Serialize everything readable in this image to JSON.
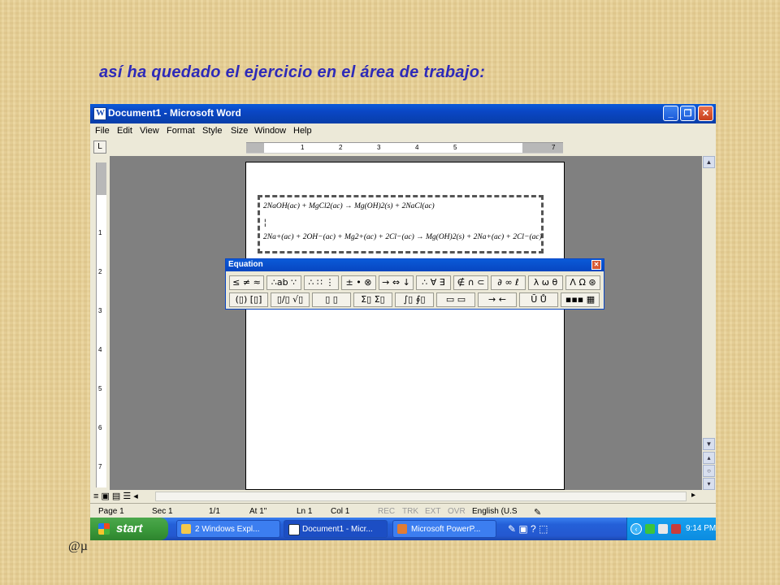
{
  "caption": "así ha quedado el ejercicio en el área de trabajo:",
  "corner_mark": "@µ",
  "window": {
    "title": "Document1 - Microsoft Word",
    "app_icon": "W",
    "buttons": {
      "minimize": "_",
      "maximize": "❐",
      "close": "✕"
    }
  },
  "menu": [
    "File",
    "Edit",
    "View",
    "Format",
    "Style",
    "Size",
    "Window",
    "Help"
  ],
  "ruler": {
    "h_numbers": [
      "1",
      "2",
      "3",
      "4",
      "5",
      "7"
    ],
    "v_numbers": [
      "1",
      "2",
      "3",
      "4",
      "5",
      "6",
      "7"
    ],
    "tab_selector": "L"
  },
  "equations": {
    "line1": "2NaOH(ac) + MgCl2(ac) → Mg(OH)2(s) + 2NaCl(ac)",
    "line2": "2Na+(ac) + 2OH−(ac) + Mg2+(ac) + 2Cl−(ac) → Mg(OH)2(s) + 2Na+(ac) + 2Cl−(ac)"
  },
  "equation_toolbar": {
    "title": "Equation",
    "row1": [
      "≤ ≠ ≈",
      "∴ab ∵",
      "∴ ∷ ⋮",
      "± • ⊗",
      "→ ⇔ ↓",
      "∴ ∀ ∃",
      "∉ ∩ ⊂",
      "∂ ∞ ℓ",
      "λ ω θ",
      "Λ Ω ⊛"
    ],
    "row2": [
      "(▯) [▯]",
      "▯/▯ √▯",
      "▯ ▯",
      "Σ▯ Σ▯",
      "∫▯ ∮▯",
      "▭ ▭",
      "→ ←",
      "Ū Ů",
      "▪▪▪ ▦"
    ]
  },
  "status_bar": {
    "page": "Page 1",
    "sec": "Sec 1",
    "pages": "1/1",
    "at": "At 1\"",
    "ln": "Ln 1",
    "col": "Col 1",
    "rec": "REC",
    "trk": "TRK",
    "ext": "EXT",
    "ovr": "OVR",
    "lang": "English (U.S"
  },
  "taskbar": {
    "start": "start",
    "tasks": [
      {
        "label": "2 Windows Expl...",
        "active": false
      },
      {
        "label": "Document1 - Micr...",
        "active": true
      },
      {
        "label": "Microsoft PowerP...",
        "active": false
      }
    ],
    "clock": "9:14 PM"
  },
  "colors": {
    "caption": "#2e2ab8",
    "titlebar": "#0a5ad8",
    "taskbar": "#2458d0",
    "start": "#3b9a3b"
  }
}
